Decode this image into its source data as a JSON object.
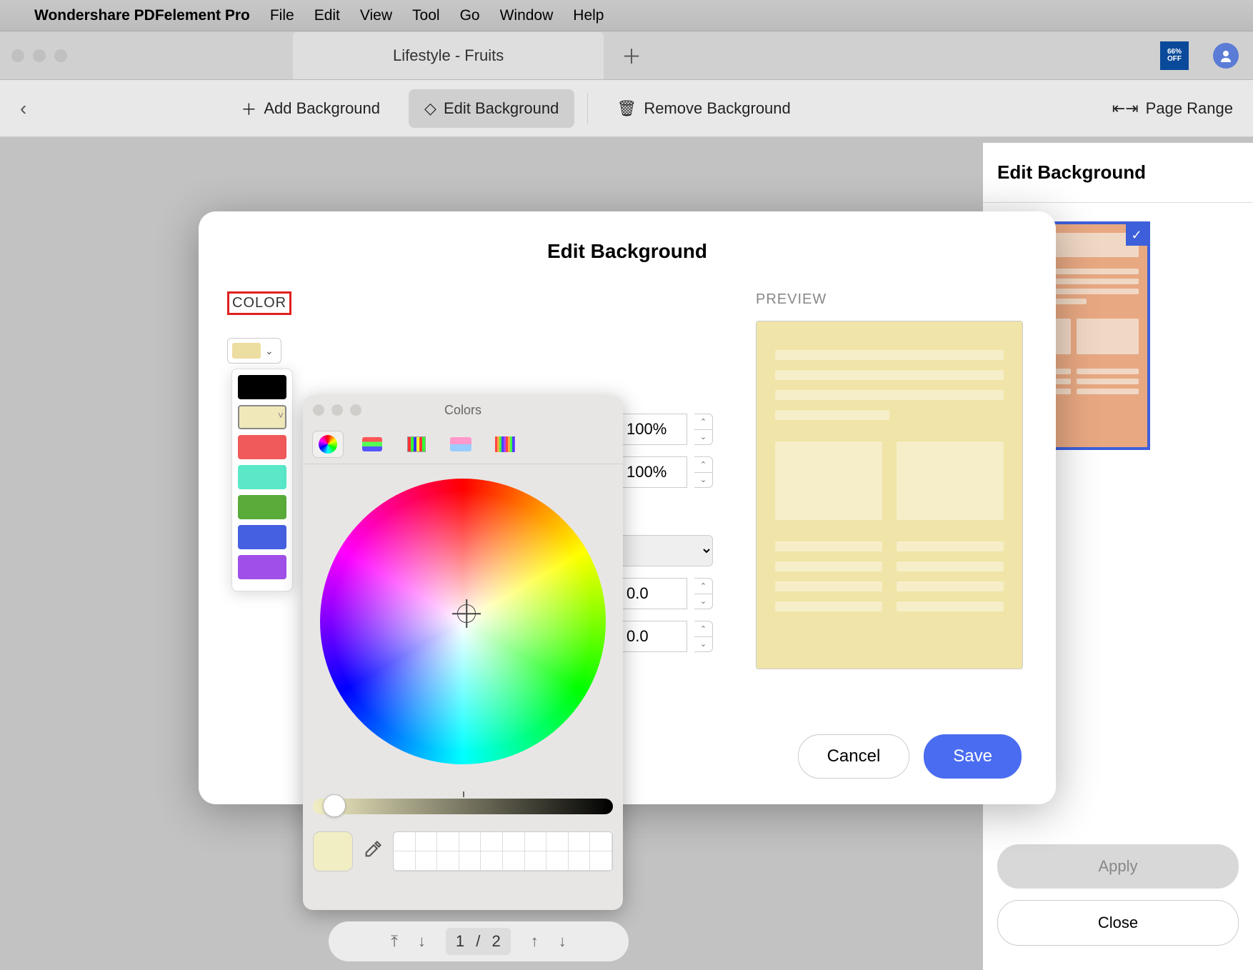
{
  "menubar": {
    "app": "Wondershare PDFelement Pro",
    "items": [
      "File",
      "Edit",
      "View",
      "Tool",
      "Go",
      "Window",
      "Help"
    ]
  },
  "tabbar": {
    "tab_title": "Lifestyle - Fruits",
    "promo_line1": "66%",
    "promo_line2": "OFF"
  },
  "toolbar": {
    "add": "Add Background",
    "edit": "Edit Background",
    "remove": "Remove Background",
    "pagerange": "Page Range"
  },
  "rightpanel": {
    "title": "Edit Background",
    "apply": "Apply",
    "close": "Close"
  },
  "dialog": {
    "title": "Edit Background",
    "color_label": "COLOR",
    "preview_label": "PREVIEW",
    "opacity": "100%",
    "scale": "100%",
    "horiz": "0.0",
    "vert": "0.0",
    "cancel": "Cancel",
    "save": "Save"
  },
  "swatches": [
    {
      "color": "#000000"
    },
    {
      "color": "#f0e8b8",
      "selected": true
    },
    {
      "color": "#f05a5a"
    },
    {
      "color": "#5ae8c8"
    },
    {
      "color": "#5aac3a"
    },
    {
      "color": "#4560e0"
    },
    {
      "color": "#a050e8"
    }
  ],
  "colorpicker": {
    "title": "Colors",
    "current_color": "#f2eec4"
  },
  "pager": {
    "current": "1",
    "sep": "/",
    "total": "2"
  }
}
